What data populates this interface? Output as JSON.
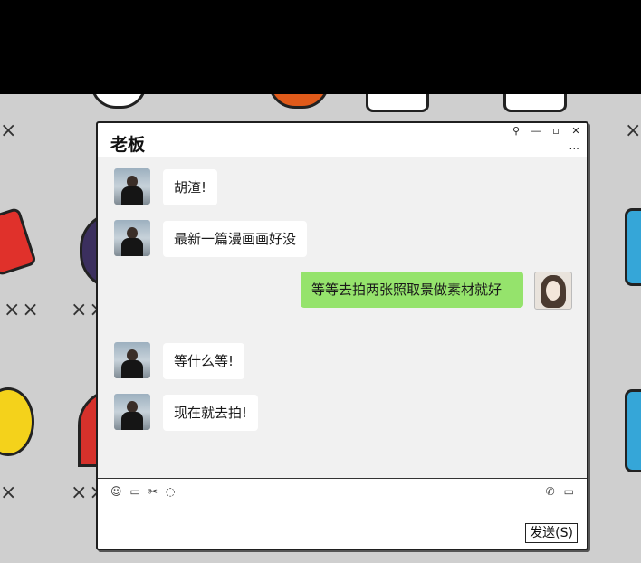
{
  "window": {
    "title": "老板",
    "controls": [
      "⚲",
      "—",
      "▫",
      "✕"
    ],
    "more": "..."
  },
  "messages": [
    {
      "sender": "boss",
      "text": "胡渣!"
    },
    {
      "sender": "boss",
      "text": "最新一篇漫画画好没"
    },
    {
      "sender": "me",
      "text": "等等去拍两张照取景做素材就好"
    },
    {
      "sender": "boss",
      "text": "等什么等!"
    },
    {
      "sender": "boss",
      "text": "现在就去拍!"
    }
  ],
  "toolbar": {
    "left_icons": [
      "emoji-icon",
      "folder-icon",
      "scissors-icon",
      "chat-history-icon"
    ],
    "right_icons": [
      "phone-icon",
      "video-icon"
    ]
  },
  "send_label": "发送(S)"
}
